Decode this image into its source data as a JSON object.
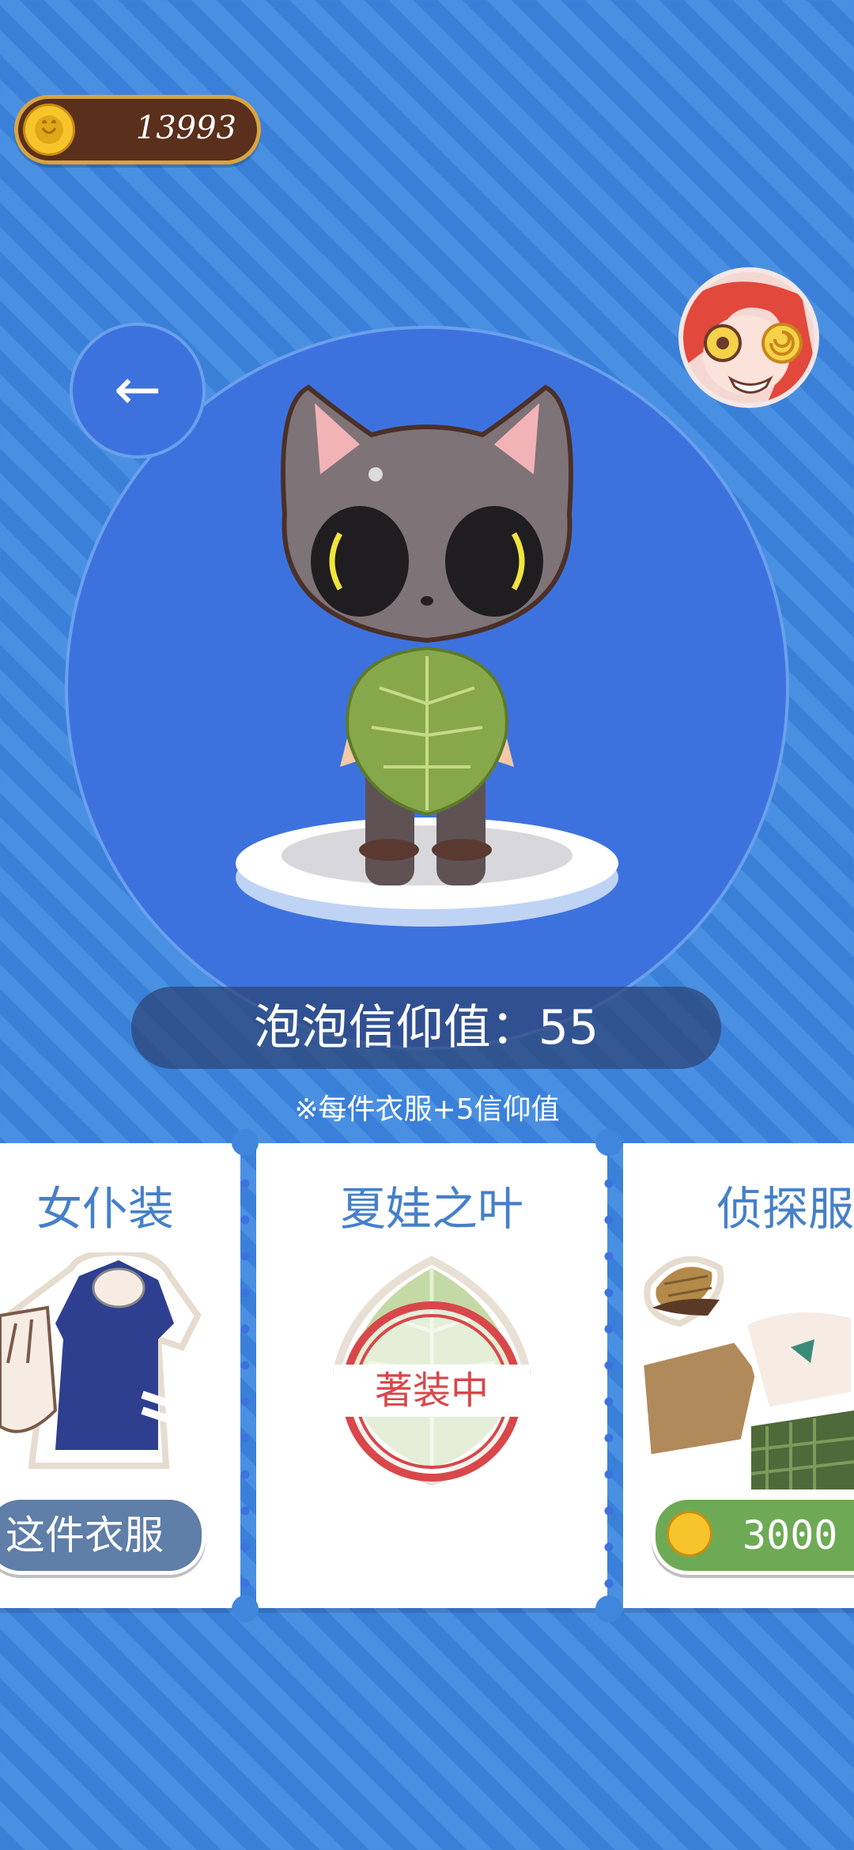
{
  "wallet": {
    "coins": "13993"
  },
  "navigation": {
    "back_icon": "←"
  },
  "faith": {
    "label": "泡泡信仰值：55",
    "note": "※每件衣服+5信仰值"
  },
  "outfits": [
    {
      "name": "女仆装",
      "button_label": "这件衣服"
    },
    {
      "name": "夏娃之叶",
      "stamp": "著装中"
    },
    {
      "name": "侦探服",
      "price": "3000"
    }
  ],
  "colors": {
    "title_blue": "#4580c8",
    "stage_blue": "#3d72de",
    "price_green": "#6eaa55",
    "stamp_red": "#d9474a"
  }
}
